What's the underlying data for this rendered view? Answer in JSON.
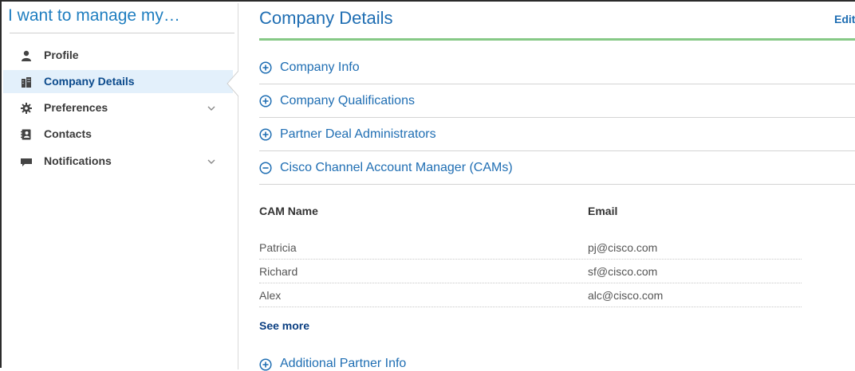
{
  "sidebar": {
    "title": "I want to manage my…",
    "items": [
      {
        "label": "Profile",
        "icon": "user-icon",
        "has_chevron": false,
        "active": false
      },
      {
        "label": "Company Details",
        "icon": "building-icon",
        "has_chevron": false,
        "active": true
      },
      {
        "label": "Preferences",
        "icon": "gear-icon",
        "has_chevron": true,
        "active": false
      },
      {
        "label": "Contacts",
        "icon": "address-book-icon",
        "has_chevron": false,
        "active": false
      },
      {
        "label": "Notifications",
        "icon": "comment-icon",
        "has_chevron": true,
        "active": false
      }
    ]
  },
  "main": {
    "title": "Company Details",
    "edit_label": "Edit",
    "sections": [
      {
        "label": "Company Info",
        "expanded": false
      },
      {
        "label": "Company Qualifications",
        "expanded": false
      },
      {
        "label": "Partner Deal Administrators",
        "expanded": false
      },
      {
        "label": "Cisco Channel Account Manager (CAMs)",
        "expanded": true
      }
    ],
    "cam_table": {
      "headers": [
        "CAM Name",
        "Email"
      ],
      "rows": [
        [
          "Patricia",
          "pj@cisco.com"
        ],
        [
          "Richard",
          "sf@cisco.com"
        ],
        [
          "Alex",
          "alc@cisco.com"
        ]
      ]
    },
    "see_more": "See more",
    "last_section": {
      "label": "Additional Partner Info",
      "expanded": false
    }
  },
  "colors": {
    "accent_blue": "#1f6eb3",
    "title_rule_green": "#86c986",
    "active_bg": "#e3f0fb",
    "link_dark_blue": "#0b3f82"
  }
}
